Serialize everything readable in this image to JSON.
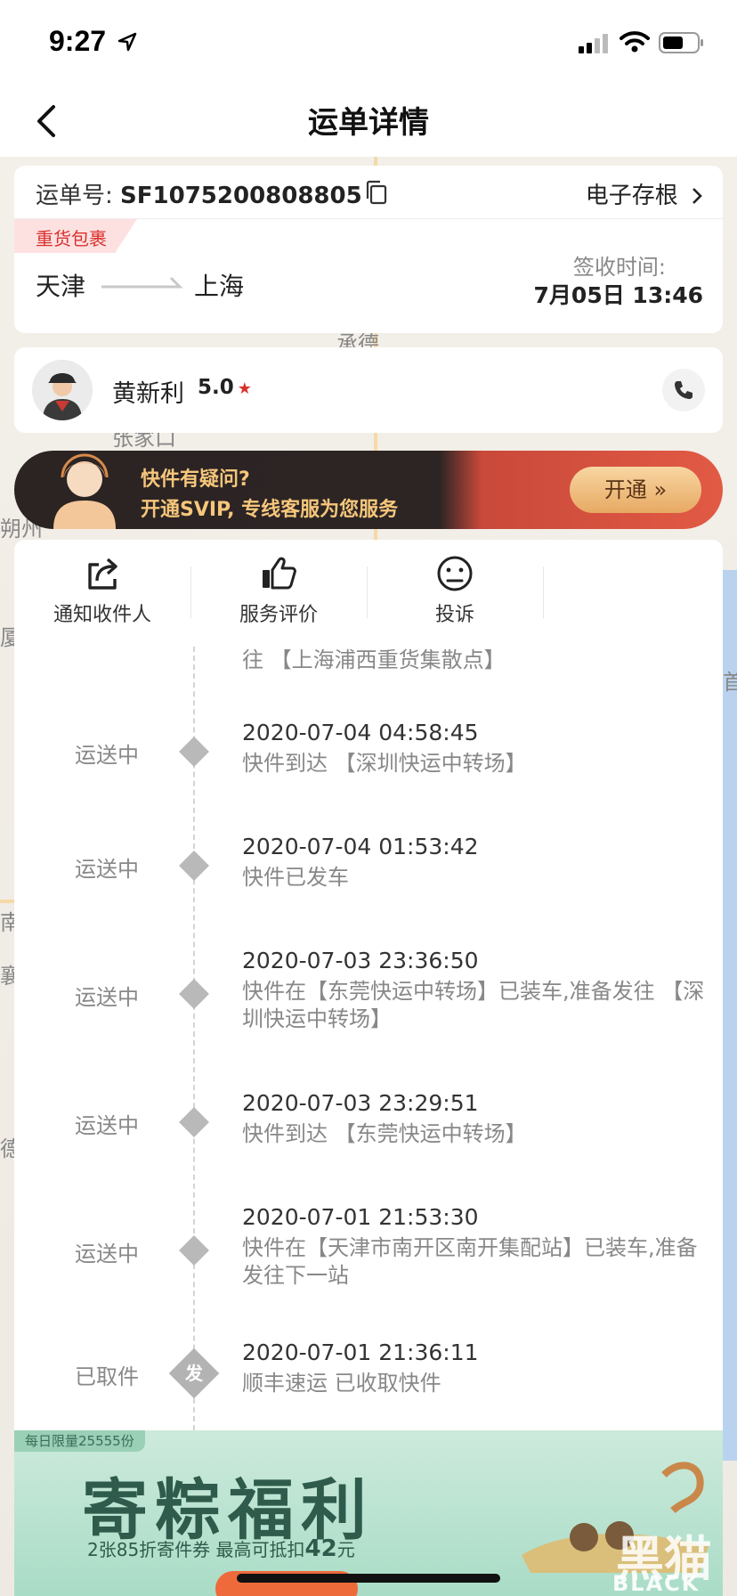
{
  "status_bar": {
    "time": "9:27"
  },
  "nav": {
    "title": "运单详情"
  },
  "waybill": {
    "label": "运单号: ",
    "number": "SF1075200808805",
    "stub_link": "电子存根",
    "tag": "重货包裹",
    "from": "天津",
    "to": "上海",
    "sign_label": "签收时间:",
    "sign_time": "7月05日 13:46"
  },
  "courier": {
    "name": "黄新利",
    "rating": "5.0"
  },
  "svip_banner": {
    "line1": "快件有疑问?",
    "line2": "开通SVIP, 专线客服为您服务",
    "button": "开通 »"
  },
  "actions": [
    {
      "label": "通知收件人",
      "icon": "share-icon"
    },
    {
      "label": "服务评价",
      "icon": "thumbs-up-icon"
    },
    {
      "label": "投诉",
      "icon": "sad-face-icon"
    }
  ],
  "timeline": {
    "partial_desc": "往 【上海浦西重货集散点】",
    "items": [
      {
        "status": "运送中",
        "time": "2020-07-04 04:58:45",
        "desc": "快件到达 【深圳快运中转场】"
      },
      {
        "status": "运送中",
        "time": "2020-07-04 01:53:42",
        "desc": "快件已发车"
      },
      {
        "status": "运送中",
        "time": "2020-07-03 23:36:50",
        "desc": "快件在【东莞快运中转场】已装车,准备发往 【深圳快运中转场】"
      },
      {
        "status": "运送中",
        "time": "2020-07-03 23:29:51",
        "desc": "快件到达 【东莞快运中转场】"
      },
      {
        "status": "运送中",
        "time": "2020-07-01 21:53:30",
        "desc": "快件在【天津市南开区南开集配站】已装车,准备发往下一站"
      },
      {
        "status": "已取件",
        "time": "2020-07-01 21:36:11",
        "desc": "顺丰速运 已收取快件",
        "node_text": "发"
      }
    ]
  },
  "ad_banner": {
    "tag": "每日限量25555份",
    "title": "寄粽福利",
    "sub_pre": "2张85折寄件券  最高可抵扣",
    "sub_amount": "42",
    "sub_unit": "元"
  },
  "watermark": {
    "cn": "黑猫",
    "en": "BLACK CAT"
  },
  "map_labels": [
    "张家口",
    "朔州",
    "承德",
    "厦",
    "首",
    "德",
    "襄",
    "南"
  ]
}
